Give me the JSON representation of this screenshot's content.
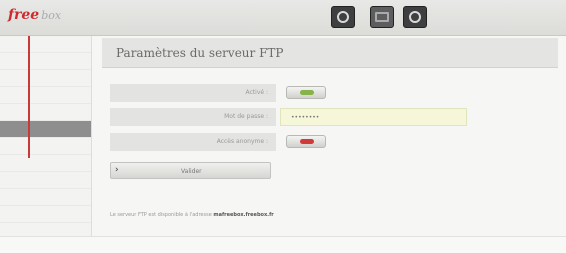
{
  "app": {
    "logo_text": "free",
    "logo_sub": "box",
    "top_icons": [
      {
        "name": "fullscreen-icon"
      },
      {
        "name": "window-icon"
      },
      {
        "name": "circle-icon"
      }
    ]
  },
  "sidebar": {
    "items": [
      {
        "label": ""
      },
      {
        "label": ""
      },
      {
        "label": ""
      },
      {
        "label": ""
      },
      {
        "label": ""
      },
      {
        "label": ""
      },
      {
        "label": ""
      },
      {
        "label": ""
      },
      {
        "label": ""
      },
      {
        "label": ""
      },
      {
        "label": ""
      }
    ],
    "active_index": 5
  },
  "page": {
    "title": "Paramètres du serveur FTP"
  },
  "form": {
    "active_label": "Activé :",
    "active_state": "on",
    "password_label": "Mot de passe :",
    "password_value": "••••••••",
    "anon_label": "Accès anonyme :",
    "anon_state": "off",
    "apply_label": "Valider"
  },
  "info": {
    "line1_prefix": "Le serveur FTP est disponible à l'adresse ",
    "line1_link": "mafreebox.freebox.fr",
    "line2": ""
  },
  "colors": {
    "accent_red": "#cf3a3a",
    "toggle_green": "#86b34a"
  }
}
